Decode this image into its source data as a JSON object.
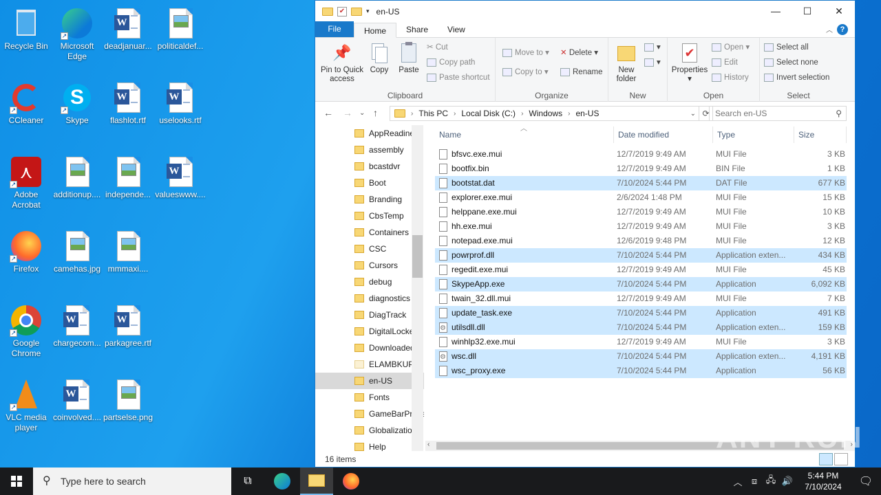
{
  "desktop": {
    "icons": [
      {
        "label": "Recycle Bin",
        "kind": "recycle"
      },
      {
        "label": "Microsoft Edge",
        "kind": "edge"
      },
      {
        "label": "deadjanuar...",
        "kind": "word"
      },
      {
        "label": "politicaldef...",
        "kind": "image"
      },
      {
        "label": "CCleaner",
        "kind": "ccleaner"
      },
      {
        "label": "Skype",
        "kind": "skype"
      },
      {
        "label": "flashlot.rtf",
        "kind": "word"
      },
      {
        "label": "uselooks.rtf",
        "kind": "word"
      },
      {
        "label": "Adobe Acrobat",
        "kind": "acrobat"
      },
      {
        "label": "additionup....",
        "kind": "image"
      },
      {
        "label": "independe...",
        "kind": "image"
      },
      {
        "label": "valueswww....",
        "kind": "word"
      },
      {
        "label": "Firefox",
        "kind": "firefox"
      },
      {
        "label": "camehas.jpg",
        "kind": "image"
      },
      {
        "label": "mmmaxi....",
        "kind": "image"
      },
      {
        "label": "Google Chrome",
        "kind": "chrome"
      },
      {
        "label": "chargecom...",
        "kind": "word"
      },
      {
        "label": "parkagree.rtf",
        "kind": "word"
      },
      {
        "label": "VLC media player",
        "kind": "vlc"
      },
      {
        "label": "coinvolved....",
        "kind": "word"
      },
      {
        "label": "partselse.png",
        "kind": "image"
      }
    ]
  },
  "explorer": {
    "title": "en-US",
    "tabs": {
      "file": "File",
      "home": "Home",
      "share": "Share",
      "view": "View"
    },
    "ribbon": {
      "pin": "Pin to Quick access",
      "copy": "Copy",
      "paste": "Paste",
      "cut": "Cut",
      "copy_path": "Copy path",
      "paste_shortcut": "Paste shortcut",
      "clipboard": "Clipboard",
      "move_to": "Move to",
      "copy_to": "Copy to",
      "delete": "Delete",
      "rename": "Rename",
      "organize": "Organize",
      "new_folder": "New folder",
      "new": "New",
      "properties": "Properties",
      "open": "Open",
      "edit": "Edit",
      "history": "History",
      "open_group": "Open",
      "select_all": "Select all",
      "select_none": "Select none",
      "invert_selection": "Invert selection",
      "select": "Select"
    },
    "address": {
      "crumbs": [
        "This PC",
        "Local Disk (C:)",
        "Windows",
        "en-US"
      ],
      "search_placeholder": "Search en-US"
    },
    "nav_items": [
      {
        "label": "AppReadiness",
        "selected": false
      },
      {
        "label": "assembly",
        "selected": false
      },
      {
        "label": "bcastdvr",
        "selected": false
      },
      {
        "label": "Boot",
        "selected": false
      },
      {
        "label": "Branding",
        "selected": false
      },
      {
        "label": "CbsTemp",
        "selected": false
      },
      {
        "label": "Containers",
        "selected": false
      },
      {
        "label": "CSC",
        "selected": false
      },
      {
        "label": "Cursors",
        "selected": false
      },
      {
        "label": "debug",
        "selected": false
      },
      {
        "label": "diagnostics",
        "selected": false
      },
      {
        "label": "DiagTrack",
        "selected": false
      },
      {
        "label": "DigitalLocker",
        "selected": false
      },
      {
        "label": "Downloaded",
        "selected": false
      },
      {
        "label": "ELAMBKUP",
        "selected": false
      },
      {
        "label": "en-US",
        "selected": true
      },
      {
        "label": "Fonts",
        "selected": false
      },
      {
        "label": "GameBarPresence",
        "selected": false
      },
      {
        "label": "Globalization",
        "selected": false
      },
      {
        "label": "Help",
        "selected": false
      }
    ],
    "columns": {
      "name": "Name",
      "date": "Date modified",
      "type": "Type",
      "size": "Size"
    },
    "files": [
      {
        "name": "bfsvc.exe.mui",
        "date": "12/7/2019 9:49 AM",
        "type": "MUI File",
        "size": "3 KB",
        "selected": false,
        "gear": false
      },
      {
        "name": "bootfix.bin",
        "date": "12/7/2019 9:49 AM",
        "type": "BIN File",
        "size": "1 KB",
        "selected": false,
        "gear": false
      },
      {
        "name": "bootstat.dat",
        "date": "7/10/2024 5:44 PM",
        "type": "DAT File",
        "size": "677 KB",
        "selected": true,
        "gear": false
      },
      {
        "name": "explorer.exe.mui",
        "date": "2/6/2024 1:48 PM",
        "type": "MUI File",
        "size": "15 KB",
        "selected": false,
        "gear": false
      },
      {
        "name": "helppane.exe.mui",
        "date": "12/7/2019 9:49 AM",
        "type": "MUI File",
        "size": "10 KB",
        "selected": false,
        "gear": false
      },
      {
        "name": "hh.exe.mui",
        "date": "12/7/2019 9:49 AM",
        "type": "MUI File",
        "size": "3 KB",
        "selected": false,
        "gear": false
      },
      {
        "name": "notepad.exe.mui",
        "date": "12/6/2019 9:48 PM",
        "type": "MUI File",
        "size": "12 KB",
        "selected": false,
        "gear": false
      },
      {
        "name": "powrprof.dll",
        "date": "7/10/2024 5:44 PM",
        "type": "Application exten...",
        "size": "434 KB",
        "selected": true,
        "gear": false
      },
      {
        "name": "regedit.exe.mui",
        "date": "12/7/2019 9:49 AM",
        "type": "MUI File",
        "size": "45 KB",
        "selected": false,
        "gear": false
      },
      {
        "name": "SkypeApp.exe",
        "date": "7/10/2024 5:44 PM",
        "type": "Application",
        "size": "6,092 KB",
        "selected": true,
        "gear": false
      },
      {
        "name": "twain_32.dll.mui",
        "date": "12/7/2019 9:49 AM",
        "type": "MUI File",
        "size": "7 KB",
        "selected": false,
        "gear": false
      },
      {
        "name": "update_task.exe",
        "date": "7/10/2024 5:44 PM",
        "type": "Application",
        "size": "491 KB",
        "selected": true,
        "gear": false
      },
      {
        "name": "utilsdll.dll",
        "date": "7/10/2024 5:44 PM",
        "type": "Application exten...",
        "size": "159 KB",
        "selected": true,
        "gear": true
      },
      {
        "name": "winhlp32.exe.mui",
        "date": "12/7/2019 9:49 AM",
        "type": "MUI File",
        "size": "3 KB",
        "selected": false,
        "gear": false
      },
      {
        "name": "wsc.dll",
        "date": "7/10/2024 5:44 PM",
        "type": "Application exten...",
        "size": "4,191 KB",
        "selected": true,
        "gear": true
      },
      {
        "name": "wsc_proxy.exe",
        "date": "7/10/2024 5:44 PM",
        "type": "Application",
        "size": "56 KB",
        "selected": true,
        "gear": false
      }
    ],
    "status": "16 items"
  },
  "watermark": "ANY RUN",
  "taskbar": {
    "search_placeholder": "Type here to search",
    "time": "5:44 PM",
    "date": "7/10/2024"
  }
}
